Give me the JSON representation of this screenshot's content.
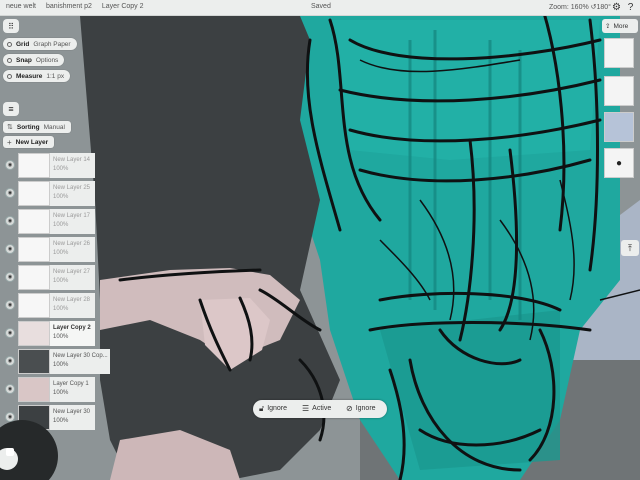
{
  "topbar": {
    "crumbs": [
      "neue welt",
      "banishment p2",
      "Layer Copy 2"
    ],
    "status": "Saved",
    "zoom": "Zoom: 160% ↺180°",
    "icons": [
      "gear-icon",
      "help-icon"
    ]
  },
  "toolbar": {
    "grid_label": "Grid",
    "grid_value": "Graph Paper",
    "snap_label": "Snap",
    "snap_value": "Options",
    "measure_label": "Measure",
    "measure_value": "1:1 px"
  },
  "layers_panel": {
    "sorting_label": "Sorting",
    "sorting_value": "Manual",
    "new_layer_label": "New Layer",
    "items": [
      {
        "name": "New Layer 14",
        "opacity": "100%"
      },
      {
        "name": "New Layer 25",
        "opacity": "100%"
      },
      {
        "name": "New Layer 17",
        "opacity": "100%"
      },
      {
        "name": "New Layer 26",
        "opacity": "100%"
      },
      {
        "name": "New Layer 27",
        "opacity": "100%"
      },
      {
        "name": "New Layer 28",
        "opacity": "100%"
      },
      {
        "name": "Layer Copy 2",
        "opacity": "100%"
      },
      {
        "name": "New Layer 30 Cop...",
        "opacity": "100%"
      },
      {
        "name": "Layer Copy 1",
        "opacity": "100%"
      },
      {
        "name": "New Layer 30",
        "opacity": "100%"
      }
    ]
  },
  "right_panel": {
    "more_label": "More"
  },
  "bottombar": {
    "left_label": "Ignore",
    "mid_label": "Active",
    "right_label": "Ignore"
  },
  "colors": {
    "teal": "#1fa89f",
    "dark_shape": "#3c4042",
    "skin": "#d0bcbd",
    "ui_bg": "#eceeed"
  }
}
